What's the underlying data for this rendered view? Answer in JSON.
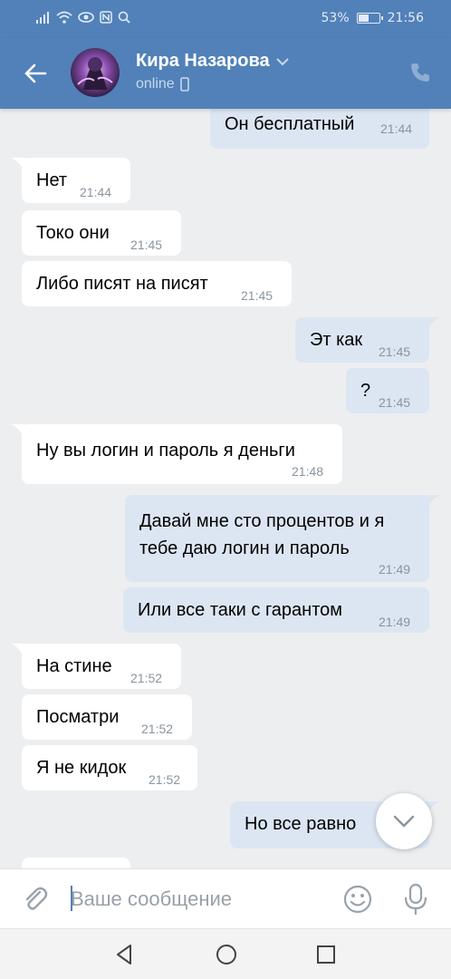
{
  "status_bar": {
    "battery_percent": "53%",
    "battery_level": 0.53,
    "time": "21:56",
    "icons": [
      "signal-icon",
      "wifi-icon",
      "eye-icon",
      "nfc-icon",
      "search-icon"
    ]
  },
  "header": {
    "contact_name": "Кира Назарова",
    "status": "online",
    "icons": [
      "back-arrow-icon",
      "chevron-down-icon",
      "phone-icon",
      "mobile-device-icon"
    ]
  },
  "messages": [
    {
      "dir": "out",
      "text": "Он бесплатный",
      "time": "21:44"
    },
    {
      "dir": "in",
      "text": "Нет",
      "time": "21:44"
    },
    {
      "dir": "in",
      "text": "Токо они",
      "time": "21:45"
    },
    {
      "dir": "in",
      "text": "Либо писят на писят",
      "time": "21:45"
    },
    {
      "dir": "out",
      "text": "Эт как",
      "time": "21:45"
    },
    {
      "dir": "out",
      "text": "?",
      "time": "21:45"
    },
    {
      "dir": "in",
      "text": "Ну вы логин и пароль я деньги",
      "time": "21:48"
    },
    {
      "dir": "out",
      "text": "Давай мне сто процентов и я тебе даю логин и пароль",
      "time": "21:49"
    },
    {
      "dir": "out",
      "text": "Или все таки с гарантом",
      "time": "21:49"
    },
    {
      "dir": "in",
      "text": "На стине",
      "time": "21:52"
    },
    {
      "dir": "in",
      "text": "Посматри",
      "time": "21:52"
    },
    {
      "dir": "in",
      "text": "Я не кидок",
      "time": "21:52"
    },
    {
      "dir": "out",
      "text": "Но все равно",
      "time": ""
    }
  ],
  "composer": {
    "placeholder": "Ваше сообщение",
    "value": "",
    "icons": [
      "paperclip-icon",
      "smile-icon",
      "microphone-icon"
    ]
  },
  "navbar": {
    "icons": [
      "back-triangle-icon",
      "home-circle-icon",
      "recents-square-icon"
    ]
  },
  "colors": {
    "header_bg": "#5181b8",
    "chat_bg": "#edeef0",
    "incoming_bubble": "#ffffff",
    "outgoing_bubble": "#dce6f3",
    "timestamp": "#8a949e"
  }
}
